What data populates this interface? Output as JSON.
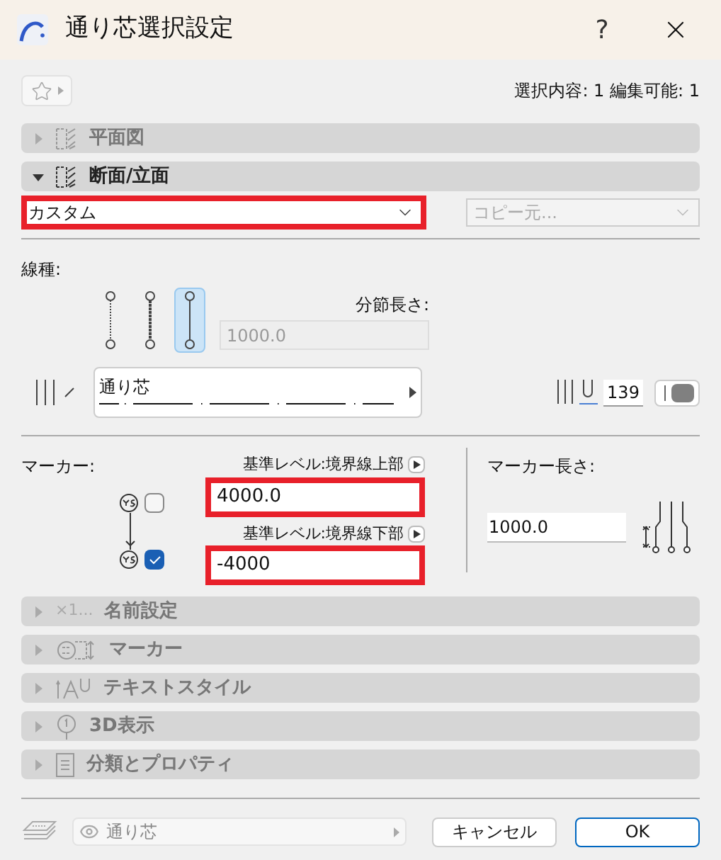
{
  "window": {
    "title": "通り芯選択設定",
    "help": "?"
  },
  "selection_info": "選択内容: 1 編集可能: 1",
  "panels_top": [
    {
      "label": "平面図",
      "expanded": false
    },
    {
      "label": "断面/立面",
      "expanded": true
    }
  ],
  "section": {
    "preset": {
      "value": "カスタム",
      "highlighted": true
    },
    "copy_from": {
      "placeholder": "コピー元...",
      "disabled": true
    },
    "line_type_label": "線種:",
    "line_styles": [
      {
        "selected": false
      },
      {
        "selected": false
      },
      {
        "selected": true
      }
    ],
    "segment_length": {
      "label": "分節長さ:",
      "value": "1000.0",
      "disabled": true
    },
    "line": {
      "name": "通り芯"
    },
    "pen": "139",
    "marker": {
      "label": "マーカー:",
      "top": {
        "label": "基準レベル:境界線上部",
        "value": "4000.0",
        "highlighted": true,
        "checked": false
      },
      "bottom": {
        "label": "基準レベル:境界線下部",
        "value": "-4000",
        "highlighted": true,
        "checked": true
      }
    },
    "marker_length": {
      "label": "マーカー長さ:",
      "value": "1000.0"
    }
  },
  "panels_bottom": [
    {
      "icon_text": "×1...",
      "label": "名前設定",
      "expanded": false
    },
    {
      "label": "マーカー",
      "expanded": false
    },
    {
      "label": "テキストスタイル",
      "expanded": false
    },
    {
      "label": "3D表示",
      "expanded": false
    },
    {
      "label": "分類とプロパティ",
      "expanded": false
    }
  ],
  "footer": {
    "layer": "通り芯",
    "buttons": [
      {
        "label": "キャンセル",
        "default": false
      },
      {
        "label": "OK",
        "default": true
      }
    ]
  }
}
